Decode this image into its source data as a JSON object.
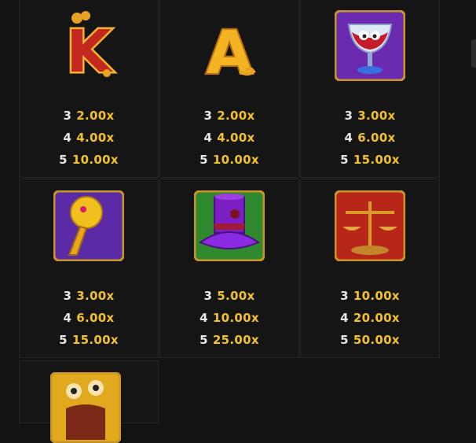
{
  "paytable": {
    "symbols": [
      {
        "name": "K",
        "pays": [
          {
            "count": "3",
            "value": "2.00x"
          },
          {
            "count": "4",
            "value": "4.00x"
          },
          {
            "count": "5",
            "value": "10.00x"
          }
        ]
      },
      {
        "name": "A",
        "pays": [
          {
            "count": "3",
            "value": "2.00x"
          },
          {
            "count": "4",
            "value": "4.00x"
          },
          {
            "count": "5",
            "value": "10.00x"
          }
        ]
      },
      {
        "name": "goblet",
        "pays": [
          {
            "count": "3",
            "value": "3.00x"
          },
          {
            "count": "4",
            "value": "6.00x"
          },
          {
            "count": "5",
            "value": "15.00x"
          }
        ]
      },
      {
        "name": "cane",
        "pays": [
          {
            "count": "3",
            "value": "3.00x"
          },
          {
            "count": "4",
            "value": "6.00x"
          },
          {
            "count": "5",
            "value": "15.00x"
          }
        ]
      },
      {
        "name": "top-hat",
        "pays": [
          {
            "count": "3",
            "value": "5.00x"
          },
          {
            "count": "4",
            "value": "10.00x"
          },
          {
            "count": "5",
            "value": "25.00x"
          }
        ]
      },
      {
        "name": "scales",
        "pays": [
          {
            "count": "3",
            "value": "10.00x"
          },
          {
            "count": "4",
            "value": "20.00x"
          },
          {
            "count": "5",
            "value": "50.00x"
          }
        ]
      },
      {
        "name": "wild-monster"
      }
    ]
  },
  "colors": {
    "background": "#131313",
    "border": "#262626",
    "multiplier": "#f2c12b",
    "count": "#e8e8e8"
  }
}
